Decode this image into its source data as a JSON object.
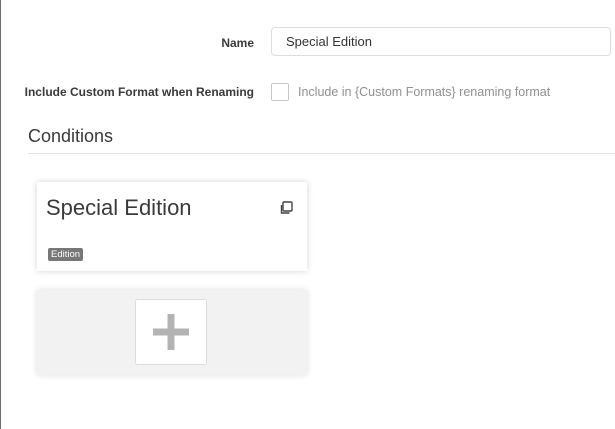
{
  "form": {
    "name_label": "Name",
    "name_value": "Special Edition",
    "include_label": "Include Custom Format when Renaming",
    "include_help": "Include in {Custom Formats} renaming format",
    "include_checked": false
  },
  "conditions": {
    "title": "Conditions",
    "cards": [
      {
        "name": "Special Edition",
        "tag": "Edition",
        "icon": "clone-icon"
      }
    ],
    "add_icon": "plus-icon"
  },
  "colors": {
    "tag_bg": "#777777",
    "plus_icon": "#b3b3b3",
    "add_card_bg": "#f2f2f2"
  }
}
